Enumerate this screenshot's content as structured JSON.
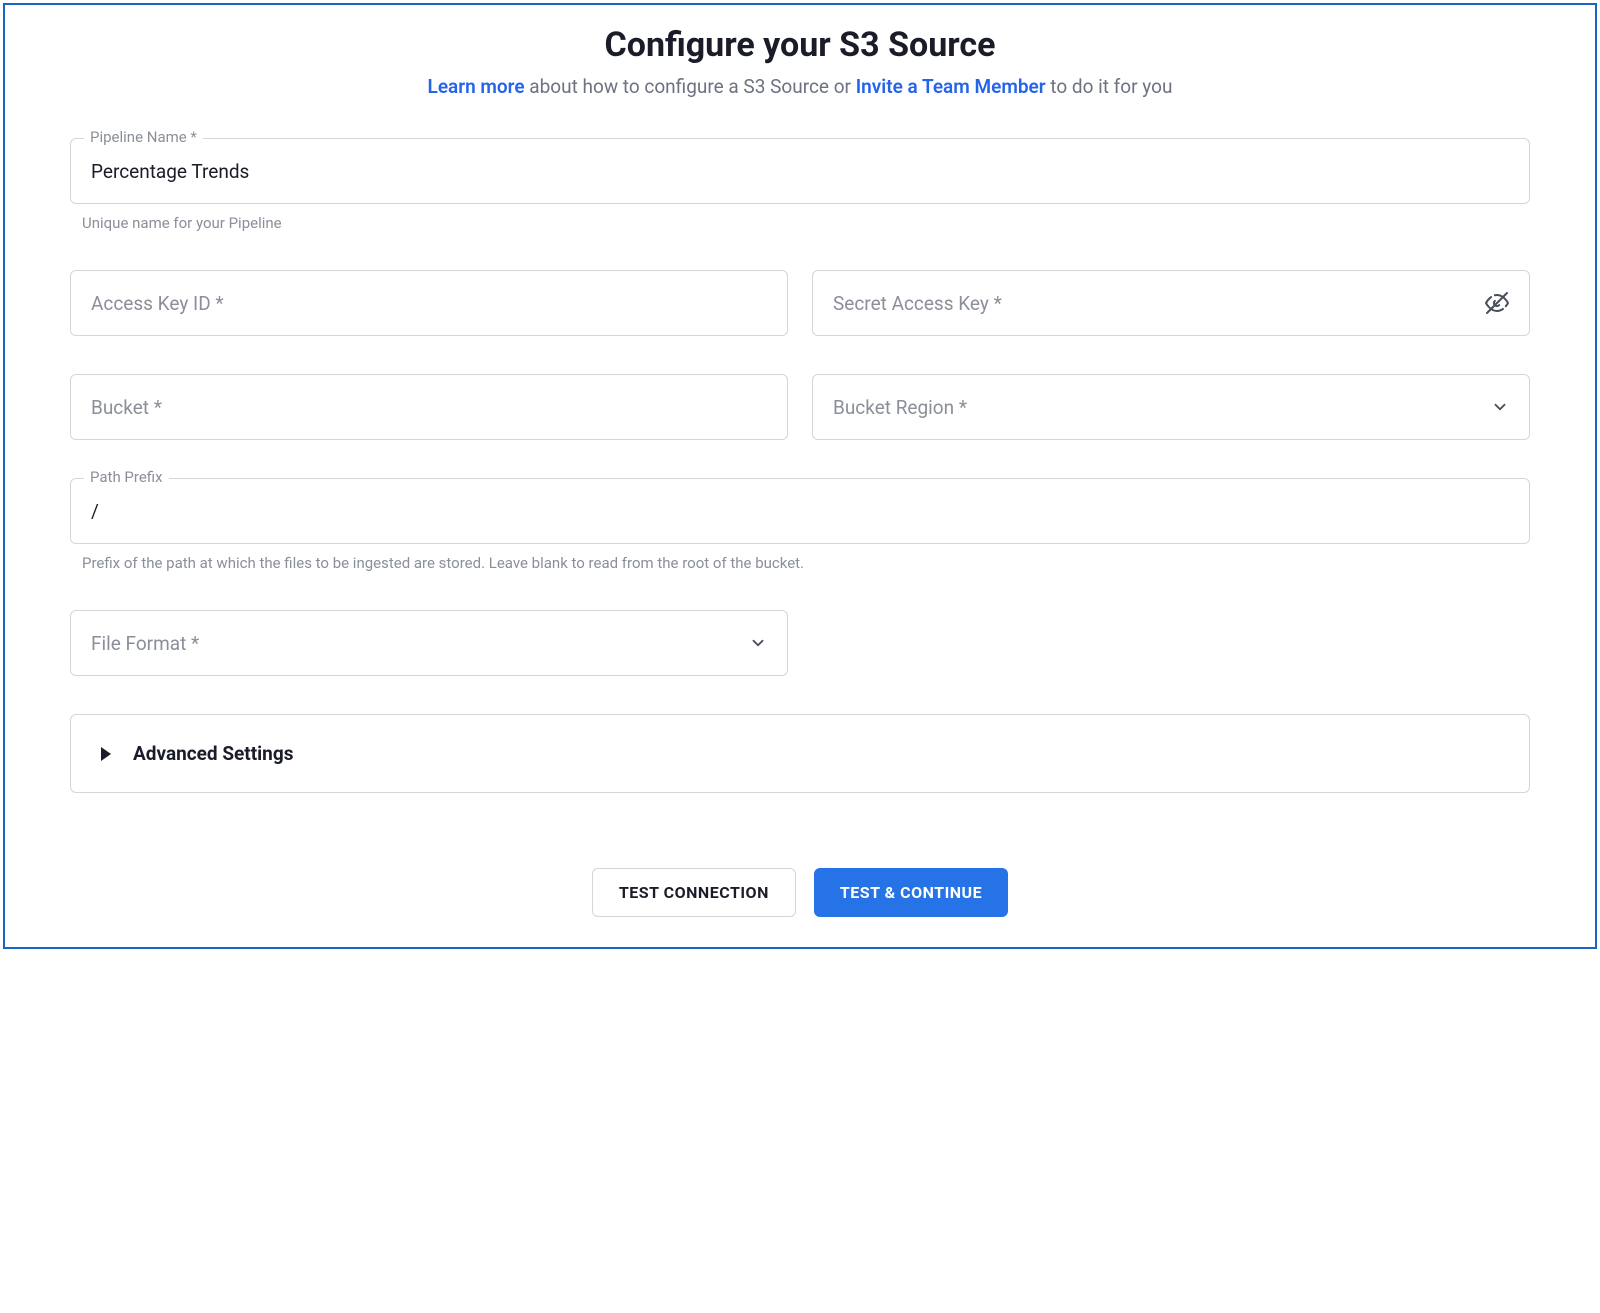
{
  "header": {
    "title": "Configure your S3 Source",
    "subtitle_learn_more": "Learn more",
    "subtitle_text1": " about how to configure a S3 Source or ",
    "subtitle_invite": "Invite a Team Member",
    "subtitle_text2": " to do it for you"
  },
  "fields": {
    "pipeline_name": {
      "label": "Pipeline Name *",
      "value": "Percentage Trends",
      "helper": "Unique name for your Pipeline"
    },
    "access_key_id": {
      "placeholder": "Access Key ID *"
    },
    "secret_access_key": {
      "placeholder": "Secret Access Key *"
    },
    "bucket": {
      "placeholder": "Bucket *"
    },
    "bucket_region": {
      "placeholder": "Bucket Region *"
    },
    "path_prefix": {
      "label": "Path Prefix",
      "value": "/",
      "helper": "Prefix of the path at which the files to be ingested are stored. Leave blank to read from the root of the bucket."
    },
    "file_format": {
      "placeholder": "File Format *"
    }
  },
  "advanced_settings_label": "Advanced Settings",
  "buttons": {
    "test_connection": "TEST CONNECTION",
    "test_continue": "TEST & CONTINUE"
  }
}
